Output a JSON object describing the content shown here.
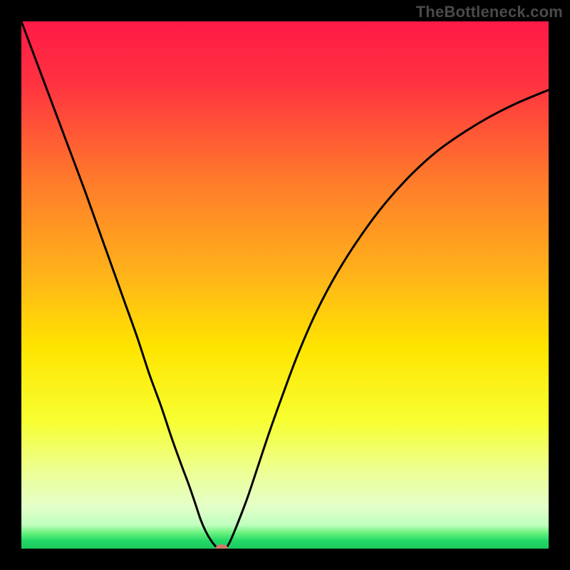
{
  "watermark": "TheBottleneck.com",
  "chart_data": {
    "type": "line",
    "title": "",
    "xlabel": "",
    "ylabel": "",
    "xlim": [
      0,
      100
    ],
    "ylim": [
      0,
      100
    ],
    "grid": false,
    "gradient_stops": [
      {
        "offset": 0.0,
        "color": "#ff1a47"
      },
      {
        "offset": 0.12,
        "color": "#ff3340"
      },
      {
        "offset": 0.3,
        "color": "#ff7a2b"
      },
      {
        "offset": 0.48,
        "color": "#ffb31a"
      },
      {
        "offset": 0.62,
        "color": "#ffe500"
      },
      {
        "offset": 0.76,
        "color": "#f7ff33"
      },
      {
        "offset": 0.86,
        "color": "#ecff9a"
      },
      {
        "offset": 0.92,
        "color": "#e4ffc8"
      },
      {
        "offset": 0.955,
        "color": "#c0ffbf"
      },
      {
        "offset": 0.97,
        "color": "#6bf27e"
      },
      {
        "offset": 0.985,
        "color": "#23d867"
      },
      {
        "offset": 1.0,
        "color": "#1cc95d"
      }
    ],
    "series": [
      {
        "name": "bottleneck-curve",
        "x": [
          0,
          3,
          6,
          9,
          12,
          14.5,
          17,
          19.5,
          22,
          24.3,
          26.5,
          28.5,
          30.3,
          31.8,
          33.0,
          34.0,
          35.0,
          36.0,
          37.0,
          38.0,
          38.7,
          39.4,
          40.3,
          41.5,
          43.0,
          45.0,
          47.0,
          49.5,
          52.5,
          56.0,
          60.0,
          64.5,
          69.0,
          74.0,
          79.0,
          84.0,
          89.0,
          94.0,
          100.0
        ],
        "values": [
          100,
          92,
          84,
          76,
          68,
          61,
          54,
          47,
          40,
          33,
          27,
          21,
          16,
          12,
          8.5,
          5.5,
          3.2,
          1.5,
          0.3,
          -0.2,
          0.0,
          1.0,
          3.0,
          6.0,
          10.0,
          16.0,
          22.0,
          29.0,
          37.0,
          45.0,
          52.5,
          59.5,
          65.5,
          71.0,
          75.5,
          79.0,
          82.0,
          84.5,
          87.0
        ]
      }
    ],
    "marker": {
      "x": 38.0,
      "y": 0.0,
      "color": "#cc7a6e",
      "rx": 9,
      "ry": 6
    },
    "stroke": {
      "color": "#000000",
      "width": 3
    }
  }
}
